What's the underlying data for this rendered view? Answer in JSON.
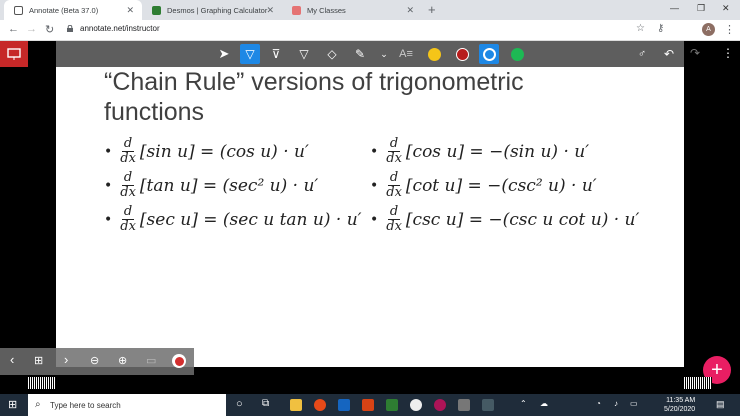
{
  "tabs": [
    {
      "title": "Annotate (Beta 37.0)",
      "active": true
    },
    {
      "title": "Desmos | Graphing Calculator",
      "active": false
    },
    {
      "title": "My Classes",
      "active": false
    }
  ],
  "address": {
    "url": "annotate.net/instructor"
  },
  "slide": {
    "title": "“Chain Rule” versions of trigonometric functions",
    "left": [
      {
        "bullet": "•",
        "num": "d",
        "den": "dx",
        "expr": "[sin u] = (cos u) · u′"
      },
      {
        "bullet": "•",
        "num": "d",
        "den": "dx",
        "expr": "[tan u] = (sec² u) · u′"
      },
      {
        "bullet": "•",
        "num": "d",
        "den": "dx",
        "expr": "[sec u] = (sec u tan u) · u′"
      }
    ],
    "right": [
      {
        "bullet": "•",
        "num": "d",
        "den": "dx",
        "expr": "[cos u] = −(sin u) · u′"
      },
      {
        "bullet": "•",
        "num": "d",
        "den": "dx",
        "expr": "[cot u] = −(csc² u) · u′"
      },
      {
        "bullet": "•",
        "num": "d",
        "den": "dx",
        "expr": "[csc u] = −(csc u cot u) · u′"
      }
    ]
  },
  "colors": {
    "yellow": "#f5c518",
    "darkred": "#b71c1c",
    "blue": "#1e88e5",
    "green": "#1db954",
    "accent": "#c62828"
  },
  "taskbar": {
    "search_placeholder": "Type here to search",
    "time": "11:35 AM",
    "date": "5/20/2020"
  }
}
